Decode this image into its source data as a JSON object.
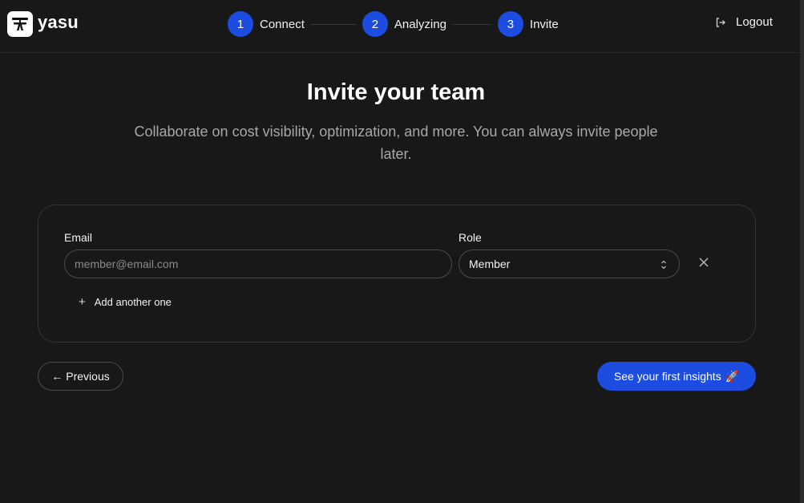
{
  "app": {
    "name": "yasu",
    "logo_icon": "yasu-logo-icon"
  },
  "stepper": {
    "steps": [
      {
        "number": "1",
        "label": "Connect"
      },
      {
        "number": "2",
        "label": "Analyzing"
      },
      {
        "number": "3",
        "label": "Invite"
      }
    ],
    "accent_color": "#1d4ce0"
  },
  "header": {
    "logout_label": "Logout",
    "logout_icon": "logout-icon"
  },
  "main": {
    "title": "Invite your team",
    "subtitle": "Collaborate on cost visibility, optimization, and more. You can always invite people later."
  },
  "invite_form": {
    "email_label": "Email",
    "email_placeholder": "member@email.com",
    "email_value": "",
    "role_label": "Role",
    "role_value": "Member",
    "remove_icon": "close-icon",
    "add_label": "Add another one"
  },
  "actions": {
    "previous_label": "Previous",
    "previous_icon": "arrow-left-icon",
    "cta_label": "See your first insights",
    "cta_emoji": "🚀"
  },
  "colors": {
    "background": "#181818",
    "primary": "#1d4ce0",
    "muted_text": "#a8a8a8"
  }
}
